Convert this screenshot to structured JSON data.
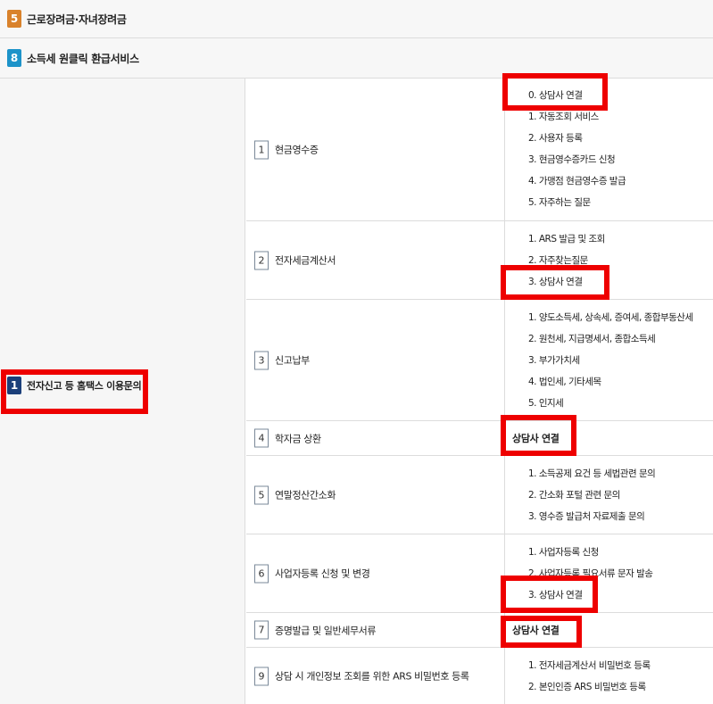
{
  "top_rows": [
    {
      "num": "5",
      "label": "근로장려금·자녀장려금",
      "color": "orange"
    },
    {
      "num": "8",
      "label": "소득세 원클릭 환급서비스",
      "color": "teal"
    }
  ],
  "main": {
    "num": "1",
    "label": "전자신고 등 홈택스 이용문의"
  },
  "categories": [
    {
      "num": "1",
      "label": "현금영수증",
      "subs": [
        "0. 상담사 연결",
        "1. 자동조회 서비스",
        "2. 사용자 등록",
        "3. 현금영수증카드 신청",
        "4. 가맹점 현금영수증 발급",
        "5. 자주하는 질문"
      ]
    },
    {
      "num": "2",
      "label": "전자세금계산서",
      "subs": [
        "1. ARS 발급 및 조회",
        "2. 자주찾는질문",
        "3. 상담사 연결"
      ]
    },
    {
      "num": "3",
      "label": "신고납부",
      "subs": [
        "1. 양도소득세, 상속세, 증여세, 종합부동산세",
        "2. 원천세, 지급명세서, 종합소득세",
        "3. 부가가치세",
        "4. 법인세, 기타세목",
        "5. 인지세"
      ]
    },
    {
      "num": "4",
      "label": "학자금 상환",
      "plain": "상담사 연결"
    },
    {
      "num": "5",
      "label": "연말정산간소화",
      "subs": [
        "1. 소득공제 요건 등 세법관련 문의",
        "2. 간소화 포털 관련 문의",
        "3. 영수증 발급처 자료제출 문의"
      ]
    },
    {
      "num": "6",
      "label": "사업자등록 신청 및 변경",
      "subs": [
        "1. 사업자등록 신청",
        "2. 사업자등록 필요서류 문자 발송",
        "3. 상담사 연결"
      ]
    },
    {
      "num": "7",
      "label": "증명발급 및 일반세무서류",
      "plain": "상담사 연결"
    },
    {
      "num": "9",
      "label": "상담 시 개인정보 조회를 위한 ARS 비밀번호 등록",
      "subs": [
        "1. 전자세금계산서 비밀번호 등록",
        "2. 본인인증 ARS 비밀번호 등록"
      ]
    }
  ],
  "colors": {
    "highlight": "#ee0000",
    "badge_orange": "#d9822b",
    "badge_teal": "#1d93c9",
    "badge_navy": "#1b3f7a"
  }
}
